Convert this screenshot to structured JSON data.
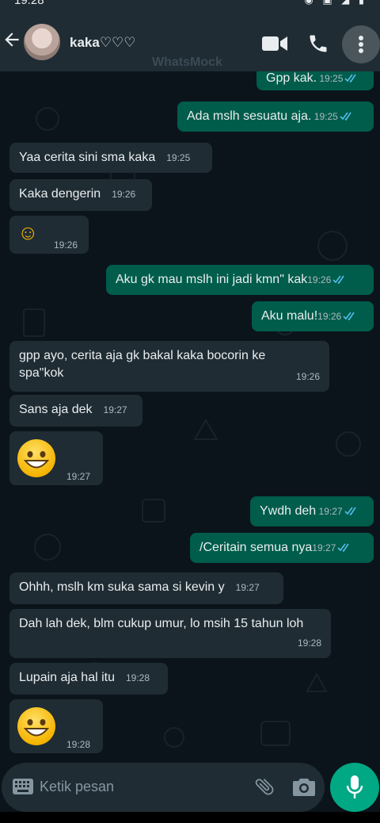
{
  "status_bar": {
    "time": "19.28",
    "icons": [
      "notification-icon",
      "download-icon",
      "whatsapp-icon",
      "alarm-icon",
      "no-signal-icon",
      "wifi-icon",
      "signal-icon",
      "battery-icon"
    ]
  },
  "header": {
    "contact_name": "kaka♡♡♡",
    "watermark": "WhatsMock"
  },
  "colors": {
    "header_bg": "#1f2c34",
    "chat_bg": "#0b141a",
    "incoming_bubble": "#1f2c34",
    "outgoing_bubble": "#005c4b",
    "read_tick": "#53bdeb",
    "mic_button": "#00a884"
  },
  "messages": [
    {
      "text": "Gpp kak.",
      "time": "19:25"
    },
    {
      "text": "Ada mslh sesuatu aja.",
      "time": "19:25"
    },
    {
      "text": "Yaa cerita sini sma kaka",
      "time": "19:25"
    },
    {
      "text": "Kaka dengerin",
      "time": "19:26"
    },
    {
      "text": "☺",
      "time": "19:26"
    },
    {
      "text": "Aku gk mau mslh ini jadi kmn\" kak",
      "time": "19:26"
    },
    {
      "text": "Aku malu!",
      "time": "19:26"
    },
    {
      "text": "gpp ayo, cerita aja gk bakal kaka bocorin ke spa\"kok",
      "time": "19:26"
    },
    {
      "text": "Sans aja dek",
      "time": "19:27"
    },
    {
      "text": "😁",
      "time": "19:27"
    },
    {
      "text": "Ywdh deh",
      "time": "19:27"
    },
    {
      "text": "/Ceritain semua nya",
      "time": "19:27"
    },
    {
      "text": "Ohhh, mslh km suka sama si kevin y",
      "time": "19:27"
    },
    {
      "text": "Dah lah dek, blm cukup umur, lo msih 15 tahun loh",
      "time": "19:28"
    },
    {
      "text": "Lupain aja hal itu",
      "time": "19:28"
    },
    {
      "text": "😁",
      "time": "19:28"
    }
  ],
  "input": {
    "placeholder": "Ketik pesan"
  }
}
